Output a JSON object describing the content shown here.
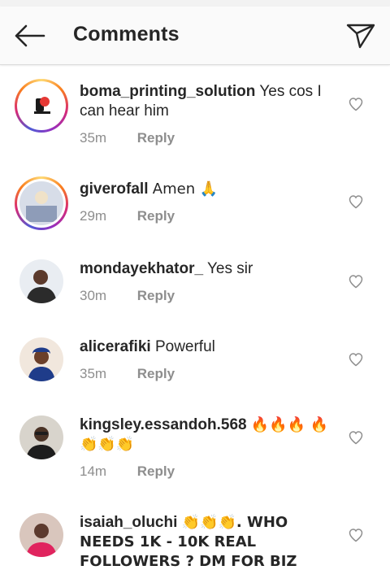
{
  "header": {
    "title": "Comments"
  },
  "comments": [
    {
      "username": "boma_printing_solution",
      "text": "Yes cos I can hear him",
      "time": "35m",
      "reply": "Reply",
      "story_ring": true,
      "avatar_colors": [
        "#ffffff",
        "#1a1a1a",
        "#e53935"
      ]
    },
    {
      "username": "giverofall",
      "text": "Amen 🙏",
      "time": "29m",
      "reply": "Reply",
      "story_ring": true,
      "avatar_colors": [
        "#d7dde8",
        "#8e9cb8",
        "#f0e2c8"
      ]
    },
    {
      "username": "mondayekhator_",
      "text": "Yes sir",
      "time": "30m",
      "reply": "Reply",
      "story_ring": false,
      "avatar_colors": [
        "#e9edf2",
        "#2b2b2b",
        "#5b3a2c"
      ]
    },
    {
      "username": "alicerafiki",
      "text": "Powerful",
      "time": "35m",
      "reply": "Reply",
      "story_ring": false,
      "avatar_colors": [
        "#f1e7dd",
        "#1f3c8a",
        "#6b3f2a"
      ]
    },
    {
      "username": "kingsley.essandoh.568",
      "text": "🔥🔥🔥 🔥👏👏👏",
      "time": "14m",
      "reply": "Reply",
      "story_ring": false,
      "avatar_colors": [
        "#d8d4cc",
        "#1d1d1d",
        "#4a3326"
      ]
    },
    {
      "username": "isaiah_oluchi",
      "text": "👏👏👏. WHO NEEDS 1K - 10K REAL FOLLOWERS ? DM FOR BIZ",
      "time": "",
      "reply": "",
      "story_ring": false,
      "avatar_colors": [
        "#d9c6bd",
        "#e0245e",
        "#5c3a2e"
      ]
    }
  ]
}
